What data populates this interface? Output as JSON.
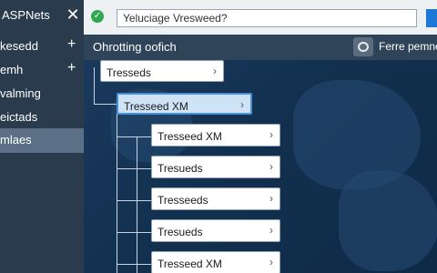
{
  "sidebar": {
    "title": "ASPNets",
    "close_icon": "close-icon",
    "items": [
      {
        "label": "kesedd",
        "has_add": true
      },
      {
        "label": "emh",
        "has_add": true
      },
      {
        "label": "valming",
        "has_add": false
      },
      {
        "label": "eictads",
        "has_add": false
      },
      {
        "label": "mlaes",
        "has_add": false,
        "active": true
      }
    ],
    "add_glyph": "+"
  },
  "topbar": {
    "status_icon": "check-circle-icon",
    "search_value": "Yeluciage Vresweed?"
  },
  "subbar": {
    "title": "Ohrotting oofich",
    "filter_icon": "filter-icon",
    "filter_label": "Ferre pemne"
  },
  "tree": {
    "root": {
      "label": "Tresseds"
    },
    "selected": {
      "label": "Tresseed XM"
    },
    "children": [
      {
        "label": "Tresseed XM"
      },
      {
        "label": "Tresueds"
      },
      {
        "label": "Tresseeds"
      },
      {
        "label": "Tresueds"
      },
      {
        "label": "Tresseed XM"
      }
    ],
    "chevron_glyph": "›"
  },
  "colors": {
    "sidebar_bg": "#2a3b4d",
    "active_item": "#5b7087",
    "selected_node": "#cfe3f7",
    "accent": "#1e78d6",
    "check": "#2fa84f"
  }
}
